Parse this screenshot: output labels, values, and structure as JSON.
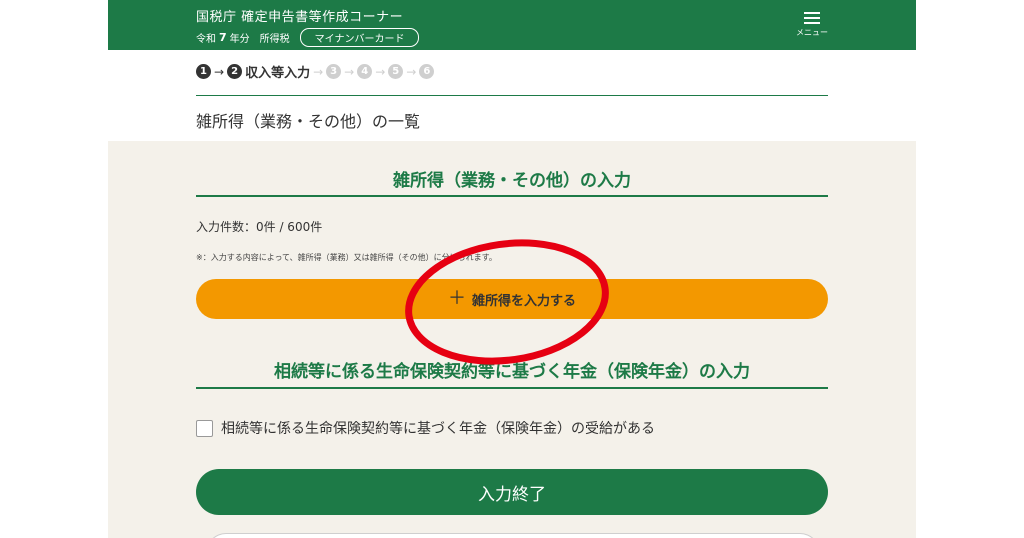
{
  "header": {
    "title": "国税庁 確定申告書等作成コーナー",
    "era": "令和",
    "year": "7",
    "year_suffix": "年分",
    "tax_type": "所得税",
    "auth_method": "マイナンバーカード",
    "menu_label": "メニュー"
  },
  "steps": {
    "items": [
      "1",
      "2",
      "3",
      "4",
      "5",
      "6"
    ],
    "current_label": "収入等入力"
  },
  "page_title": "雑所得（業務・その他）の一覧",
  "misc_section": {
    "title": "雑所得（業務・その他）の入力",
    "count_text": "入力件数：0件 / 600件",
    "note": "※：入力する内容によって、雑所得（業務）又は雑所得（その他）に分けられます。",
    "add_button": "雑所得を入力する",
    "add_icon": "plus-icon"
  },
  "pension_section": {
    "title": "相続等に係る生命保険契約等に基づく年金（保険年金）の入力",
    "checkbox_label": "相続等に係る生命保険契約等に基づく年金（保険年金）の受給がある",
    "checked": false
  },
  "finish_button": "入力終了",
  "colors": {
    "brand_green": "#1d7a47",
    "orange": "#f39800",
    "panel_bg": "#f4f1ea",
    "annotation_red": "#e60012"
  }
}
